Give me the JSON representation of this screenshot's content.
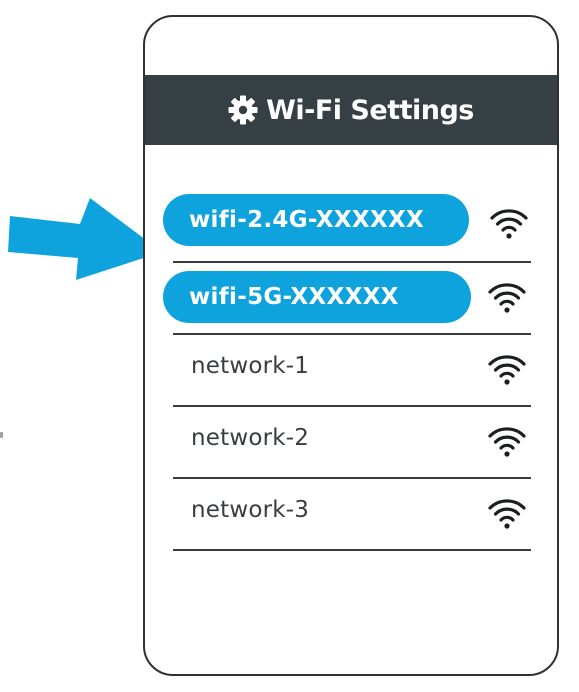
{
  "header": {
    "title": "Wi-Fi Settings",
    "title_icon": "gear-icon"
  },
  "networks": [
    {
      "name": "wifi-2.4G-XXXXXX",
      "highlighted": true,
      "icon": "wifi-signal-icon"
    },
    {
      "name": "wifi-5G-XXXXXX",
      "highlighted": true,
      "icon": "wifi-signal-icon"
    },
    {
      "name": "network-1",
      "highlighted": false,
      "icon": "wifi-signal-icon"
    },
    {
      "name": "network-2",
      "highlighted": false,
      "icon": "wifi-signal-icon"
    },
    {
      "name": "network-3",
      "highlighted": false,
      "icon": "wifi-signal-icon"
    }
  ],
  "pointer": {
    "icon": "arrow-right-icon",
    "target": "wifi-2.4G-XXXXXX"
  },
  "colors": {
    "accent": "#0fa3dd",
    "title_bar": "#353f44",
    "frame": "#2f3133",
    "text": "#3a3d40"
  }
}
